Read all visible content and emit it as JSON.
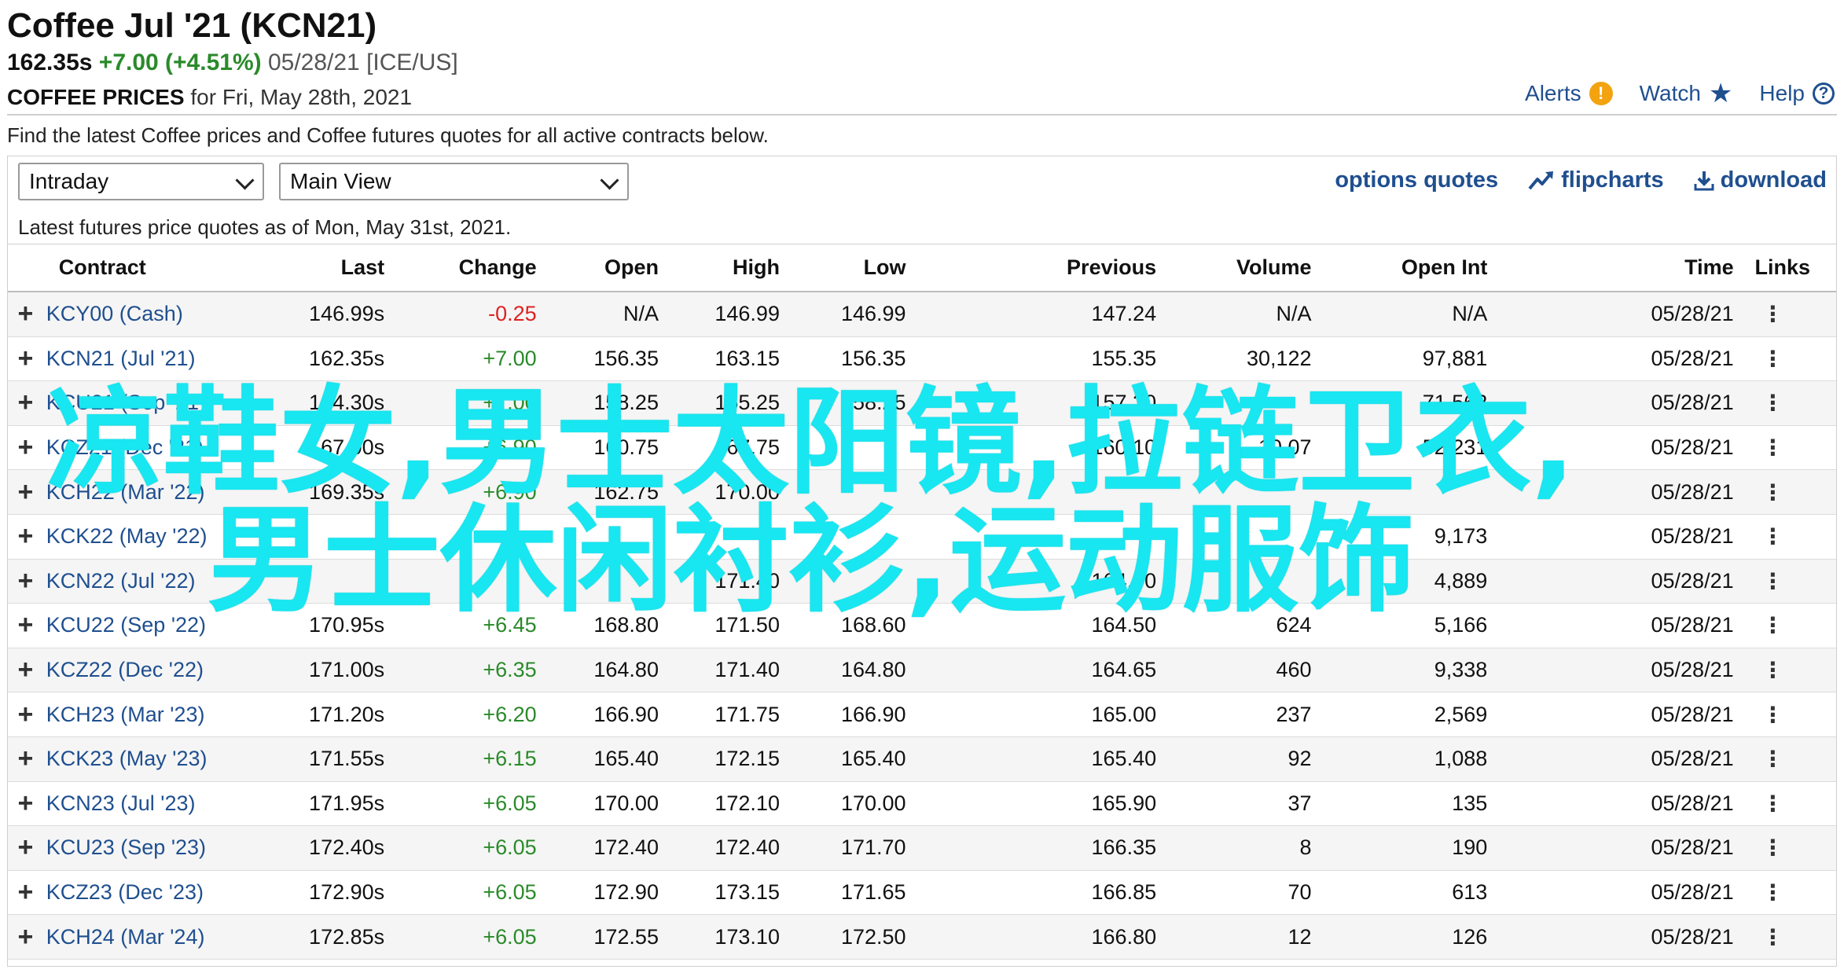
{
  "header": {
    "title": "Coffee Jul '21 (KCN21)",
    "last": "162.35s",
    "change": "+7.00 (+4.51%)",
    "meta": "05/28/21 [ICE/US]",
    "prices_label": "COFFEE PRICES",
    "prices_for": "for Fri, May 28th, 2021"
  },
  "top_links": {
    "alerts": "Alerts",
    "watch": "Watch",
    "help": "Help"
  },
  "description": "Find the latest Coffee prices and Coffee futures quotes for all active contracts below.",
  "controls": {
    "period_select": "Intraday",
    "view_select": "Main View",
    "options_quotes": "options quotes",
    "flipcharts": "flipcharts",
    "download": "download"
  },
  "as_of": "Latest futures price quotes as of Mon, May 31st, 2021.",
  "columns": [
    "Contract",
    "Last",
    "Change",
    "Open",
    "High",
    "Low",
    "Previous",
    "Volume",
    "Open Int",
    "Time",
    "Links"
  ],
  "rows": [
    {
      "contract": "KCY00 (Cash)",
      "last": "146.99s",
      "change": "-0.25",
      "open": "N/A",
      "high": "146.99",
      "low": "146.99",
      "previous": "147.24",
      "volume": "N/A",
      "open_int": "N/A",
      "time": "05/28/21"
    },
    {
      "contract": "KCN21 (Jul '21)",
      "last": "162.35s",
      "change": "+7.00",
      "open": "156.35",
      "high": "163.15",
      "low": "156.35",
      "previous": "155.35",
      "volume": "30,122",
      "open_int": "97,881",
      "time": "05/28/21"
    },
    {
      "contract": "KCU21 (Sep '21)",
      "last": "164.30s",
      "change": "+7.00",
      "open": "158.25",
      "high": "165.25",
      "low": "158.25",
      "previous": "157.30",
      "volume": "",
      "open_int": "71,562",
      "time": "05/28/21"
    },
    {
      "contract": "KCZ21 (Dec '21)",
      "last": "167.00s",
      "change": "+6.90",
      "open": "160.75",
      "high": "167.75",
      "low": "",
      "previous": "160.10",
      "volume": "10,07",
      "open_int": "52,231",
      "time": "05/28/21"
    },
    {
      "contract": "KCH22 (Mar '22)",
      "last": "169.35s",
      "change": "+6.90",
      "open": "162.75",
      "high": "170.00",
      "low": "",
      "previous": "",
      "volume": "",
      "open_int": "",
      "time": "05/28/21"
    },
    {
      "contract": "KCK22 (May '22)",
      "last": "",
      "change": "",
      "open": "",
      "high": "",
      "low": "",
      "previous": "",
      "volume": "",
      "open_int": "9,173",
      "time": "05/28/21"
    },
    {
      "contract": "KCN22 (Jul '22)",
      "last": "",
      "change": "",
      "open": "",
      "high": "171.40",
      "low": "",
      "previous": "164.00",
      "volume": "",
      "open_int": "4,889",
      "time": "05/28/21"
    },
    {
      "contract": "KCU22 (Sep '22)",
      "last": "170.95s",
      "change": "+6.45",
      "open": "168.80",
      "high": "171.50",
      "low": "168.60",
      "previous": "164.50",
      "volume": "624",
      "open_int": "5,166",
      "time": "05/28/21"
    },
    {
      "contract": "KCZ22 (Dec '22)",
      "last": "171.00s",
      "change": "+6.35",
      "open": "164.80",
      "high": "171.40",
      "low": "164.80",
      "previous": "164.65",
      "volume": "460",
      "open_int": "9,338",
      "time": "05/28/21"
    },
    {
      "contract": "KCH23 (Mar '23)",
      "last": "171.20s",
      "change": "+6.20",
      "open": "166.90",
      "high": "171.75",
      "low": "166.90",
      "previous": "165.00",
      "volume": "237",
      "open_int": "2,569",
      "time": "05/28/21"
    },
    {
      "contract": "KCK23 (May '23)",
      "last": "171.55s",
      "change": "+6.15",
      "open": "165.40",
      "high": "172.15",
      "low": "165.40",
      "previous": "165.40",
      "volume": "92",
      "open_int": "1,088",
      "time": "05/28/21"
    },
    {
      "contract": "KCN23 (Jul '23)",
      "last": "171.95s",
      "change": "+6.05",
      "open": "170.00",
      "high": "172.10",
      "low": "170.00",
      "previous": "165.90",
      "volume": "37",
      "open_int": "135",
      "time": "05/28/21"
    },
    {
      "contract": "KCU23 (Sep '23)",
      "last": "172.40s",
      "change": "+6.05",
      "open": "172.40",
      "high": "172.40",
      "low": "171.70",
      "previous": "166.35",
      "volume": "8",
      "open_int": "190",
      "time": "05/28/21"
    },
    {
      "contract": "KCZ23 (Dec '23)",
      "last": "172.90s",
      "change": "+6.05",
      "open": "172.90",
      "high": "173.15",
      "low": "171.65",
      "previous": "166.85",
      "volume": "70",
      "open_int": "613",
      "time": "05/28/21"
    },
    {
      "contract": "KCH24 (Mar '24)",
      "last": "172.85s",
      "change": "+6.05",
      "open": "172.55",
      "high": "173.10",
      "low": "172.50",
      "previous": "166.80",
      "volume": "12",
      "open_int": "126",
      "time": "05/28/21"
    }
  ],
  "overlay": {
    "line1": "凉鞋女,男士太阳镜,拉链卫衣,",
    "line2": "男士休闲衬衫,运动服饰"
  },
  "colors": {
    "link": "#1f4f8f",
    "positive": "#2a8a2a",
    "negative": "#dd2222",
    "overlay": "#18e6f0",
    "alert": "#f2a30f"
  }
}
